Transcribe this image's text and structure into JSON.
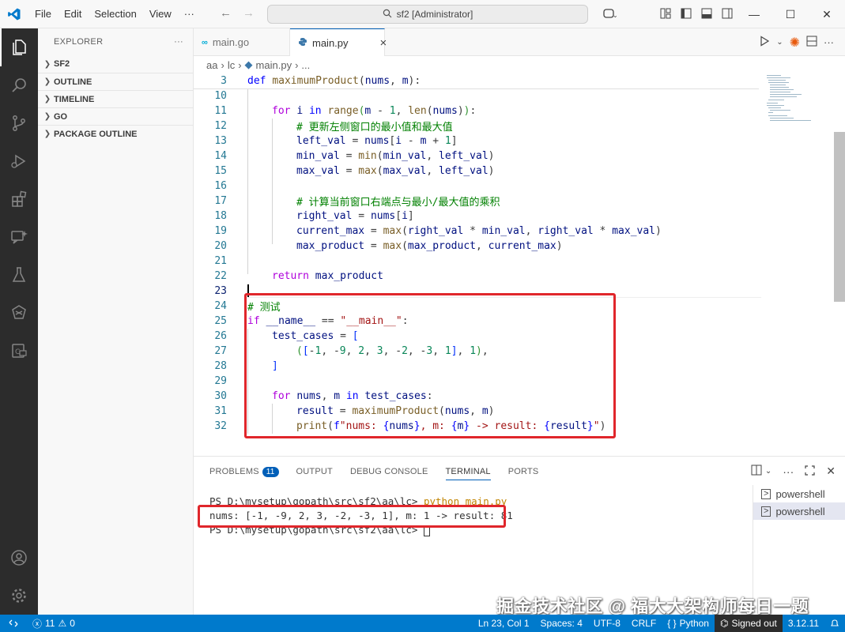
{
  "titlebar": {
    "menu": [
      "File",
      "Edit",
      "Selection",
      "View",
      "···"
    ],
    "search": "sf2 [Administrator]",
    "window_controls": [
      "minimize-icon",
      "maximize-icon",
      "close-icon"
    ]
  },
  "activity_bar": [
    "files-icon",
    "search-icon",
    "source-control-icon",
    "run-debug-icon",
    "extensions-icon",
    "remote-explorer-icon",
    "testing-icon",
    "go-icon",
    "docker-icon",
    "account-icon",
    "settings-gear-icon"
  ],
  "sidebar": {
    "title": "EXPLORER",
    "more": "···",
    "sections": [
      "SF2",
      "OUTLINE",
      "TIMELINE",
      "GO",
      "PACKAGE OUTLINE"
    ]
  },
  "tabs": [
    {
      "label": "main.go",
      "icon": "go-file-icon",
      "active": false
    },
    {
      "label": "main.py",
      "icon": "python-file-icon",
      "active": true,
      "close": "×"
    }
  ],
  "breadcrumb": [
    "aa",
    "lc",
    "main.py",
    "..."
  ],
  "editor": {
    "line_numbers": [
      "3",
      "10",
      "11",
      "12",
      "13",
      "14",
      "15",
      "16",
      "17",
      "18",
      "19",
      "20",
      "21",
      "22",
      "23",
      "24",
      "25",
      "26",
      "27",
      "28",
      "29",
      "30",
      "31",
      "32"
    ],
    "comment_1": "# 更新左侧窗口的最小值和最大值",
    "comment_2": "# 计算当前窗口右端点与最小/最大值的乘积",
    "comment_3": "# 测试"
  },
  "panel": {
    "tabs": [
      {
        "label": "PROBLEMS",
        "badge": "11"
      },
      {
        "label": "OUTPUT"
      },
      {
        "label": "DEBUG CONSOLE"
      },
      {
        "label": "TERMINAL",
        "active": true
      },
      {
        "label": "PORTS"
      }
    ],
    "terminal": {
      "prompt_1": "PS D:\\mysetup\\gopath\\src\\sf2\\aa\\lc> ",
      "command": "python main.py",
      "output": "nums: [-1, -9, 2, 3, -2, -3, 1], m: 1 -> result: 81",
      "prompt_2": "PS D:\\mysetup\\gopath\\src\\sf2\\aa\\lc> "
    },
    "terminal_list": [
      "powershell",
      "powershell"
    ]
  },
  "watermark": "掘金技术社区 @ 福大大架构师每日一题",
  "statusbar": {
    "errors": "11",
    "warnings": "0",
    "position": "Ln 23, Col 1",
    "spaces": "Spaces: 4",
    "encoding": "UTF-8",
    "eol": "CRLF",
    "language": "Python",
    "signed": "Signed out",
    "version": "3.12.11"
  },
  "colors": {
    "statusbar": "#007acc",
    "activitybar": "#2c2c2c",
    "highlight_box": "#e0262b"
  }
}
